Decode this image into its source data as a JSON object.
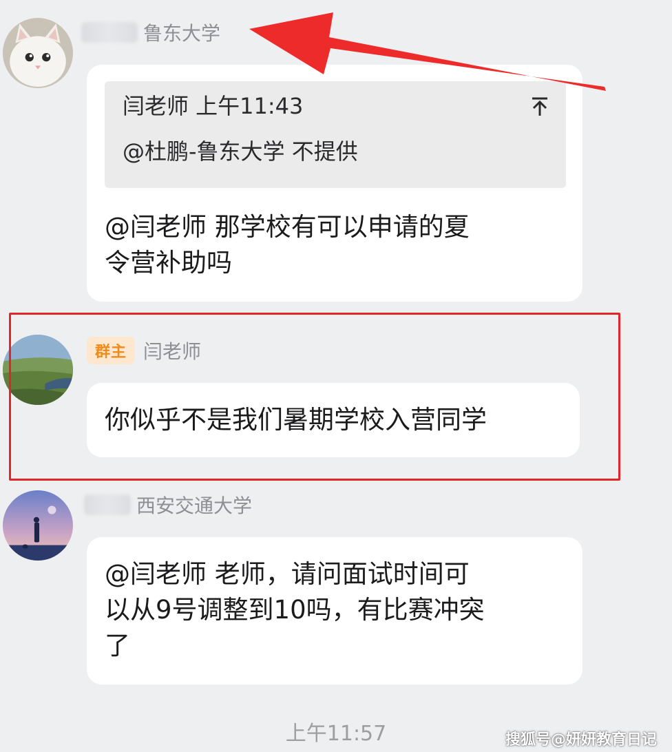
{
  "messages": [
    {
      "sender_school": "鲁东大学",
      "quote": {
        "author_time": "闫老师 上午11:43",
        "text": "@杜鹏-鲁东大学 不提供",
        "icon": "arrow-up-bar-icon"
      },
      "lines": [
        "@闫老师 那学校有可以申请的夏",
        "令营补助吗"
      ]
    },
    {
      "badge": "群主",
      "sender_name": "闫老师",
      "lines": [
        "你似乎不是我们暑期学校入营同学"
      ]
    },
    {
      "sender_school": "西安交通大学",
      "lines": [
        "@闫老师 老师，请问面试时间可",
        "以从9号调整到10吗，有比赛冲突",
        "了"
      ]
    }
  ],
  "timestamp": "上午11:57",
  "watermark": "搜狐号@妍妍教育日记",
  "colors": {
    "highlight": "#e0262b",
    "arrow": "#ee2b2b",
    "badge_bg": "#fde8cf",
    "badge_text": "#f08a1a",
    "background": "#eeeff1"
  }
}
